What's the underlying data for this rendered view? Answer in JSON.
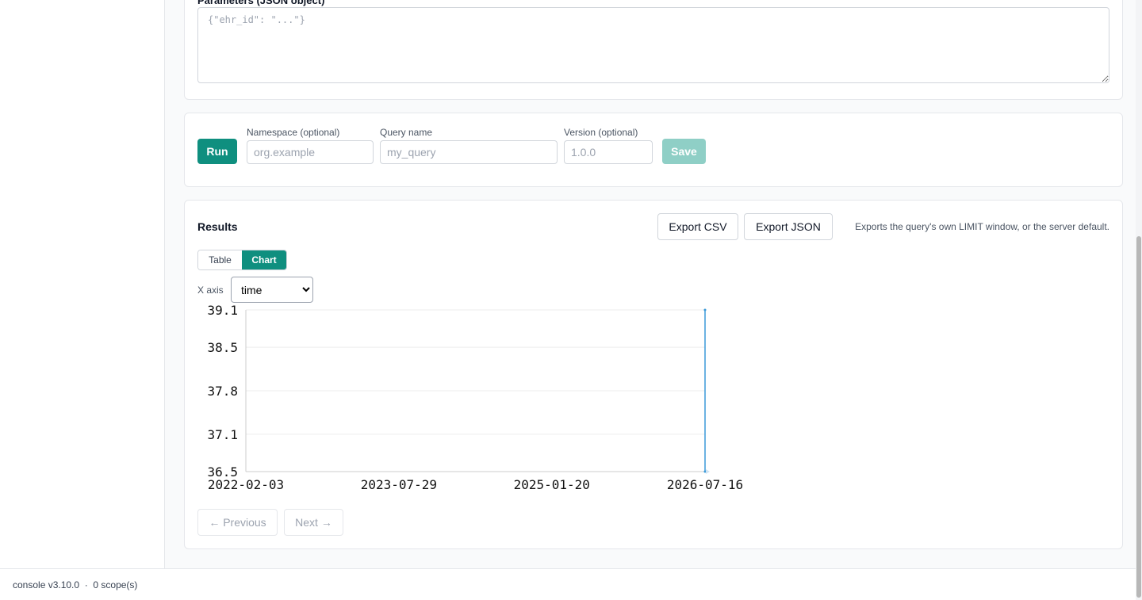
{
  "params": {
    "label": "Parameters (JSON object)",
    "placeholder": "{\"ehr_id\": \"...\"}"
  },
  "run_bar": {
    "run_label": "Run",
    "namespace_label": "Namespace (optional)",
    "namespace_placeholder": "org.example",
    "query_name_label": "Query name",
    "query_name_placeholder": "my_query",
    "version_label": "Version (optional)",
    "version_placeholder": "1.0.0",
    "save_label": "Save"
  },
  "results": {
    "title": "Results",
    "export_csv": "Export CSV",
    "export_json": "Export JSON",
    "export_note": "Exports the query's own LIMIT window, or the server default.",
    "view_table": "Table",
    "view_chart": "Chart",
    "active_view": "Chart",
    "x_axis_label": "X axis",
    "x_axis_value": "time",
    "previous_label": "← Previous",
    "next_label": "Next →"
  },
  "chart_data": {
    "type": "line",
    "x_ticks": [
      "2022-02-03",
      "2023-07-29",
      "2025-01-20",
      "2026-07-16"
    ],
    "y_ticks": [
      "36.5",
      "37.1",
      "37.8",
      "38.5",
      "39.1"
    ],
    "ylim": [
      36.5,
      39.1
    ],
    "xlim": [
      "2022-02-03",
      "2026-07-16"
    ],
    "grid": true,
    "series": [
      {
        "x": [
          "2026-07-16",
          "2026-07-16"
        ],
        "y": [
          36.5,
          39.1
        ],
        "color": "#3b9ad9"
      }
    ]
  },
  "footer": {
    "text": "console v3.10.0  ·  0 scope(s)"
  },
  "colors": {
    "accent": "#0f8f7f",
    "line": "#3b9ad9"
  }
}
